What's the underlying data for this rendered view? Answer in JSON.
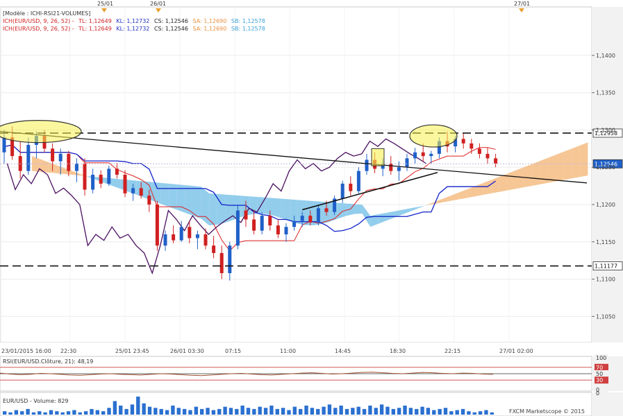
{
  "chart_data": {
    "type": "line",
    "header": {
      "model": "[Modèle : ICHI-RSI21-VOLUMES]",
      "line1": {
        "prefix": "ICH(EUR/USD, 9, 26, 52) -",
        "tl": "TL: 1,12649",
        "kl": "KL: 1,12732",
        "cs": "CS: 1,12546",
        "sa": "SA: 1,12690",
        "sb": "SB: 1,12578"
      },
      "line2": {
        "prefix": "ICH(EUR/USD, 9, 26, 52) -",
        "tl": "TL: 1,12649",
        "kl": "KL: 1,12732",
        "cs": "CS: 1,12546",
        "sa": "SA: 1,12690",
        "sb": "SB: 1,12578"
      }
    },
    "top_date_markers": [
      "25/01",
      "26/01",
      "27/01"
    ],
    "y_ticks": [
      "1,1400",
      "1,1350",
      "1,1300",
      "1,1250",
      "1,1200",
      "1,1150",
      "1,1100",
      "1,1050"
    ],
    "y_ticks_values": [
      1.14,
      1.135,
      1.13,
      1.125,
      1.12,
      1.115,
      1.11,
      1.105
    ],
    "ylim": [
      1.1015,
      1.1465
    ],
    "x_ticks": [
      "23/01/2015 16:00",
      "22:30",
      "25/01 23:45",
      "26/01 03:30",
      "07:15",
      "11:00",
      "14:45",
      "18:30",
      "22:15",
      "27/01 02:00"
    ],
    "price_tags": [
      {
        "label": "1,12958",
        "value": 1.12958
      },
      {
        "label": "1,12546",
        "value": 1.12546
      },
      {
        "label": "1,11177",
        "value": 1.11177
      }
    ],
    "rsi": {
      "label": "RSI(EUR/USD.Clôture, 21): 48,19",
      "levels": [
        "100",
        "70",
        "50",
        "30",
        "0"
      ],
      "levels_values": [
        100,
        70,
        50,
        30,
        0
      ],
      "values": [
        52,
        49,
        47,
        48,
        51,
        50,
        48,
        46,
        45,
        47,
        49,
        50,
        48,
        47,
        46,
        48,
        50,
        49,
        47,
        45,
        44,
        46,
        48,
        50,
        51,
        49,
        47,
        46,
        48,
        50,
        52,
        53,
        51,
        49,
        50,
        52,
        54,
        55,
        53,
        51,
        50,
        52,
        54,
        53,
        51,
        50,
        52,
        51,
        49,
        48
      ]
    },
    "volume": {
      "label": "EUR/USD - Volume: 829",
      "zero": "0",
      "values": [
        3,
        2,
        4,
        3,
        5,
        2,
        3,
        2,
        4,
        3,
        2,
        3,
        4,
        2,
        3,
        5,
        4,
        3,
        6,
        12,
        8,
        5,
        9,
        16,
        10,
        7,
        6,
        5,
        4,
        8,
        6,
        5,
        4,
        7,
        5,
        6,
        4,
        5,
        7,
        6,
        5,
        8,
        6,
        5,
        7,
        6,
        8,
        5,
        6,
        4,
        7,
        5,
        8,
        6,
        5,
        7,
        9,
        6,
        8,
        5,
        6,
        7,
        5,
        8,
        6,
        9,
        7,
        5,
        6,
        8,
        6,
        5,
        7,
        6,
        4,
        5,
        6,
        3,
        4,
        5,
        3,
        2,
        3,
        4,
        2
      ]
    },
    "candles": [
      [
        1.127,
        1.13,
        1.1255,
        1.129
      ],
      [
        1.129,
        1.1305,
        1.126,
        1.1265
      ],
      [
        1.1265,
        1.1285,
        1.1235,
        1.1245
      ],
      [
        1.1245,
        1.129,
        1.124,
        1.128
      ],
      [
        1.128,
        1.1298,
        1.1262,
        1.1292
      ],
      [
        1.1292,
        1.13,
        1.127,
        1.1275
      ],
      [
        1.1275,
        1.1282,
        1.1245,
        1.1258
      ],
      [
        1.1258,
        1.1275,
        1.124,
        1.1268
      ],
      [
        1.1268,
        1.1272,
        1.1238,
        1.1245
      ],
      [
        1.1245,
        1.1262,
        1.123,
        1.1255
      ],
      [
        1.1255,
        1.1262,
        1.1212,
        1.122
      ],
      [
        1.122,
        1.1248,
        1.1215,
        1.124
      ],
      [
        1.124,
        1.1246,
        1.1222,
        1.1228
      ],
      [
        1.1228,
        1.1252,
        1.1225,
        1.1248
      ],
      [
        1.1248,
        1.1256,
        1.1235,
        1.124
      ],
      [
        1.124,
        1.1246,
        1.121,
        1.1215
      ],
      [
        1.1215,
        1.1228,
        1.1205,
        1.1222
      ],
      [
        1.1222,
        1.123,
        1.1208,
        1.1212
      ],
      [
        1.1212,
        1.122,
        1.119,
        1.12
      ],
      [
        1.12,
        1.1205,
        1.1138,
        1.1145
      ],
      [
        1.1145,
        1.1165,
        1.1138,
        1.116
      ],
      [
        1.116,
        1.1172,
        1.1148,
        1.1152
      ],
      [
        1.1152,
        1.1178,
        1.115,
        1.117
      ],
      [
        1.117,
        1.1178,
        1.1148,
        1.1155
      ],
      [
        1.1155,
        1.1165,
        1.114,
        1.116
      ],
      [
        1.116,
        1.1168,
        1.114,
        1.1145
      ],
      [
        1.1145,
        1.1158,
        1.1128,
        1.1135
      ],
      [
        1.1135,
        1.1145,
        1.11,
        1.1108
      ],
      [
        1.1108,
        1.115,
        1.1098,
        1.1145
      ],
      [
        1.1145,
        1.12,
        1.114,
        1.1192
      ],
      [
        1.1192,
        1.1205,
        1.117,
        1.118
      ],
      [
        1.118,
        1.1192,
        1.116,
        1.1165
      ],
      [
        1.1165,
        1.119,
        1.116,
        1.1185
      ],
      [
        1.1185,
        1.1192,
        1.1165,
        1.1172
      ],
      [
        1.1172,
        1.118,
        1.1155,
        1.116
      ],
      [
        1.116,
        1.1175,
        1.115,
        1.117
      ],
      [
        1.117,
        1.1185,
        1.1165,
        1.1178
      ],
      [
        1.1178,
        1.119,
        1.117,
        1.1185
      ],
      [
        1.1185,
        1.1192,
        1.1172,
        1.1176
      ],
      [
        1.1176,
        1.12,
        1.1172,
        1.1195
      ],
      [
        1.1195,
        1.1205,
        1.1185,
        1.119
      ],
      [
        1.119,
        1.1212,
        1.1186,
        1.1208
      ],
      [
        1.1208,
        1.1232,
        1.1202,
        1.1228
      ],
      [
        1.1228,
        1.1238,
        1.1212,
        1.1218
      ],
      [
        1.1218,
        1.125,
        1.1215,
        1.1245
      ],
      [
        1.1245,
        1.1268,
        1.124,
        1.126
      ],
      [
        1.126,
        1.127,
        1.1242,
        1.1248
      ],
      [
        1.1248,
        1.1262,
        1.1238,
        1.1255
      ],
      [
        1.1255,
        1.1265,
        1.124,
        1.1245
      ],
      [
        1.1245,
        1.1258,
        1.1232,
        1.125
      ],
      [
        1.125,
        1.1268,
        1.1245,
        1.1262
      ],
      [
        1.1262,
        1.1276,
        1.1255,
        1.127
      ],
      [
        1.127,
        1.1282,
        1.1258,
        1.1265
      ],
      [
        1.1265,
        1.1272,
        1.1255,
        1.1268
      ],
      [
        1.1268,
        1.129,
        1.1262,
        1.1285
      ],
      [
        1.1285,
        1.1298,
        1.127,
        1.1278
      ],
      [
        1.1278,
        1.1292,
        1.127,
        1.1288
      ],
      [
        1.1288,
        1.1295,
        1.1275,
        1.1282
      ],
      [
        1.1282,
        1.1288,
        1.1268,
        1.1275
      ],
      [
        1.1275,
        1.1282,
        1.1262,
        1.1268
      ],
      [
        1.1268,
        1.1276,
        1.1255,
        1.1262
      ],
      [
        1.1262,
        1.1268,
        1.125,
        1.1255
      ]
    ]
  }
}
